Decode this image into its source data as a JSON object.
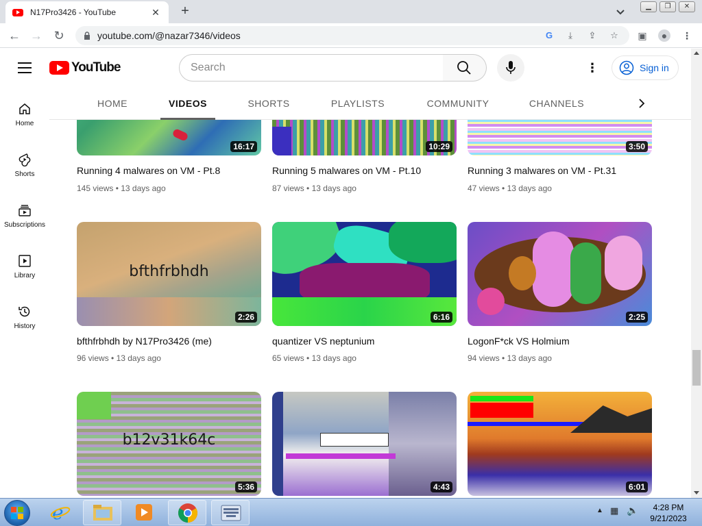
{
  "browser": {
    "tab_title": "N17Pro3426 - YouTube",
    "url": "youtube.com/@nazar7346/videos"
  },
  "header": {
    "logo_text": "YouTube",
    "search_placeholder": "Search",
    "sign_in": "Sign in"
  },
  "sidebar": {
    "items": [
      {
        "label": "Home",
        "icon": "home-icon"
      },
      {
        "label": "Shorts",
        "icon": "shorts-icon"
      },
      {
        "label": "Subscriptions",
        "icon": "subscriptions-icon"
      },
      {
        "label": "Library",
        "icon": "library-icon"
      },
      {
        "label": "History",
        "icon": "history-icon"
      }
    ]
  },
  "channel_tabs": [
    "HOME",
    "VIDEOS",
    "SHORTS",
    "PLAYLISTS",
    "COMMUNITY",
    "CHANNELS"
  ],
  "active_tab": "VIDEOS",
  "videos": [
    {
      "title": "Running 4 malwares on VM - Pt.8",
      "views": "145 views",
      "age": "13 days ago",
      "duration": "16:17"
    },
    {
      "title": "Running 5 malwares on VM - Pt.10",
      "views": "87 views",
      "age": "13 days ago",
      "duration": "10:29"
    },
    {
      "title": "Running 3 malwares on VM - Pt.31",
      "views": "47 views",
      "age": "13 days ago",
      "duration": "3:50"
    },
    {
      "title": "bfthfrbhdh by N17Pro3426 (me)",
      "views": "96 views",
      "age": "13 days ago",
      "duration": "2:26",
      "thumb_text": "bfthfrbhdh"
    },
    {
      "title": "quantizer VS neptunium",
      "views": "65 views",
      "age": "13 days ago",
      "duration": "6:16"
    },
    {
      "title": "LogonF*ck VS Holmium",
      "views": "94 views",
      "age": "13 days ago",
      "duration": "2:25"
    },
    {
      "title": "",
      "views": "",
      "age": "",
      "duration": "5:36",
      "thumb_text": "b12v31k64c"
    },
    {
      "title": "",
      "views": "",
      "age": "",
      "duration": "4:43"
    },
    {
      "title": "",
      "views": "",
      "age": "",
      "duration": "6:01"
    }
  ],
  "taskbar": {
    "time": "4:28 PM",
    "date": "9/21/2023"
  }
}
